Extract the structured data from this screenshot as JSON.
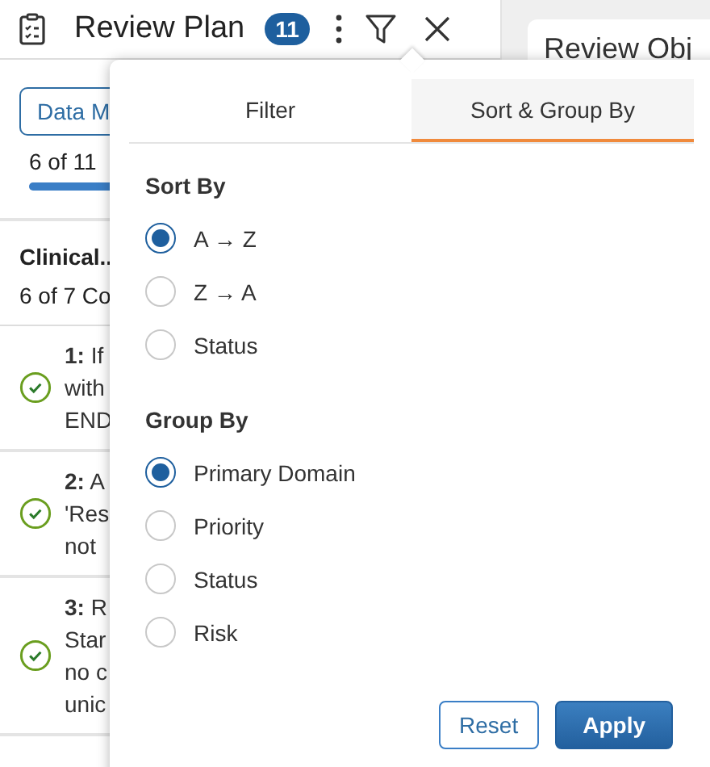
{
  "header": {
    "title": "Review Plan",
    "count": "11"
  },
  "side_panel": {
    "button": "Data M",
    "progress_text": "6 of 11",
    "progress": {
      "level": 0.55
    },
    "group": {
      "title": "Clinical..",
      "subtitle": "6 of 7 Co"
    },
    "items": [
      {
        "lines": [
          "**1:** If",
          "with",
          "END"
        ]
      },
      {
        "lines": [
          "**2:** A",
          "'Res",
          "not"
        ]
      },
      {
        "lines": [
          "**3:** R",
          "Star",
          "no c",
          "unic"
        ]
      }
    ]
  },
  "right_card": {
    "title": "Review Obj"
  },
  "popover": {
    "tabs": [
      {
        "label": "Filter",
        "selected": false
      },
      {
        "label": "Sort & Group By",
        "selected": true
      }
    ],
    "sections": [
      {
        "title": "Sort By",
        "options": [
          {
            "label": "A → Z",
            "selected": true
          },
          {
            "label": "Z → A",
            "selected": false
          },
          {
            "label": "Status",
            "selected": false
          }
        ]
      },
      {
        "title": "Group By",
        "options": [
          {
            "label": "Primary Domain",
            "selected": true
          },
          {
            "label": "Priority",
            "selected": false
          },
          {
            "label": "Status",
            "selected": false
          },
          {
            "label": "Risk",
            "selected": false
          }
        ]
      }
    ],
    "buttons": [
      {
        "label": "Reset",
        "kind": "secondary"
      },
      {
        "label": "Apply",
        "kind": "primary"
      }
    ]
  }
}
